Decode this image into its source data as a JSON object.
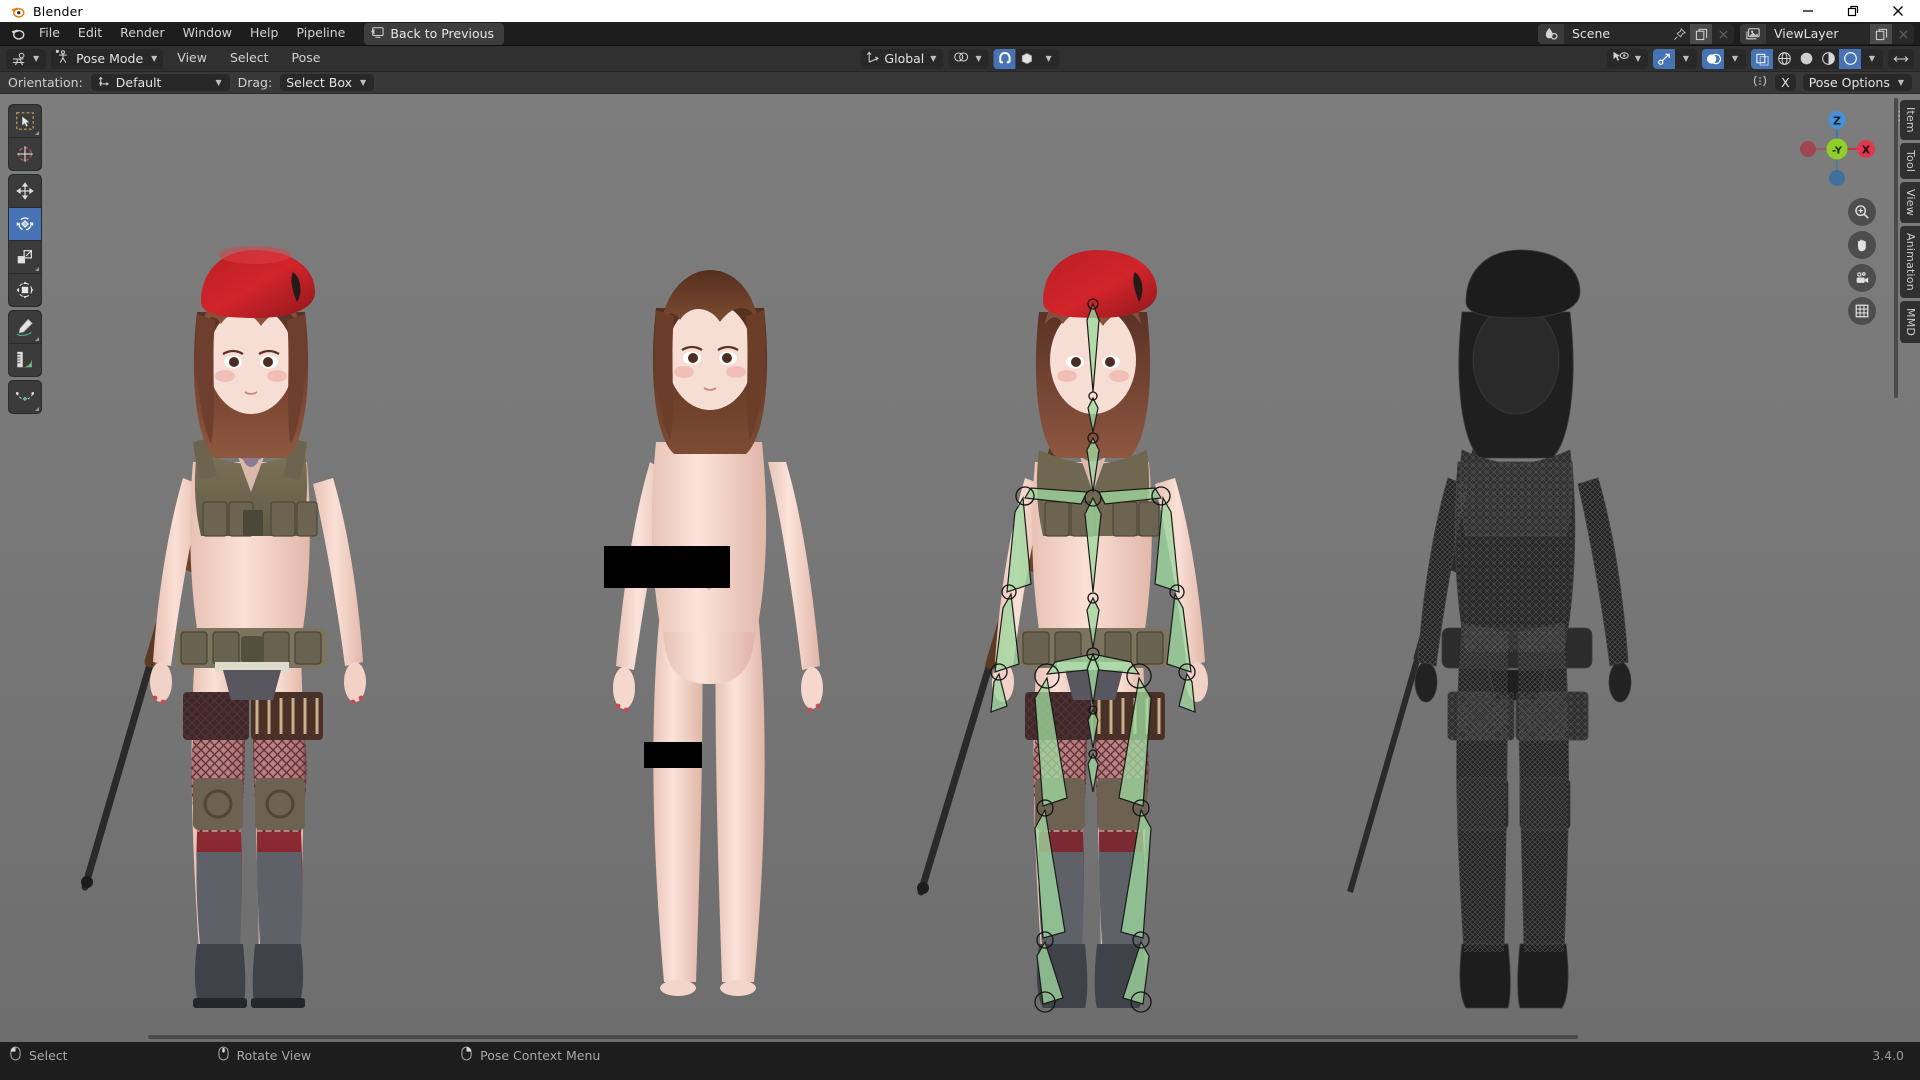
{
  "window": {
    "title": "Blender",
    "controls": {
      "minimize": "minimize",
      "maximize": "maximize",
      "close": "close"
    }
  },
  "topbar": {
    "menus": [
      "File",
      "Edit",
      "Render",
      "Window",
      "Help",
      "Pipeline"
    ],
    "back_button": "Back to Previous",
    "scene": {
      "label": "Scene",
      "name_value": "Scene"
    },
    "viewlayer": {
      "label": "ViewLayer",
      "name_value": "ViewLayer"
    }
  },
  "viewport_header": {
    "editor_type": "editor-type-3dview",
    "mode": "Pose Mode",
    "menus": [
      "View",
      "Select",
      "Pose"
    ],
    "transform_orientation": "Global",
    "snap_enabled": true,
    "proportional_editing": false,
    "shading": {
      "wireframe": false,
      "solid": false,
      "material": false,
      "rendered": true
    },
    "gizmo_enabled": true,
    "overlays_enabled": true,
    "xray": false
  },
  "tool_settings": {
    "orientation_label": "Orientation:",
    "orientation_value": "Default",
    "drag_label": "Drag:",
    "drag_value": "Select Box",
    "xmirror_label": "X",
    "pose_options": "Pose Options"
  },
  "toolbar": {
    "tools": [
      {
        "name": "tool-select-box",
        "label": "Select Box",
        "active": false
      },
      {
        "name": "tool-cursor",
        "label": "Cursor",
        "active": false
      },
      {
        "name": "tool-move",
        "label": "Move",
        "active": false
      },
      {
        "name": "tool-rotate",
        "label": "Rotate",
        "active": true
      },
      {
        "name": "tool-scale",
        "label": "Scale",
        "active": false
      },
      {
        "name": "tool-transform",
        "label": "Transform",
        "active": false
      },
      {
        "name": "tool-annotate",
        "label": "Annotate",
        "active": false
      },
      {
        "name": "tool-measure",
        "label": "Measure",
        "active": false
      },
      {
        "name": "tool-breakdowner",
        "label": "Breakdowner",
        "active": false
      }
    ]
  },
  "sidebar": {
    "tabs": [
      {
        "label": "Item",
        "active": false
      },
      {
        "label": "Tool",
        "active": false
      },
      {
        "label": "View",
        "active": false
      },
      {
        "label": "Animation",
        "active": false
      },
      {
        "label": "MMD",
        "active": false
      }
    ]
  },
  "nav_gizmo": {
    "axes": [
      {
        "label": "Z",
        "color": "#4a8fd4",
        "active": false
      },
      {
        "label": "-Y",
        "color": "#8fcf2a",
        "active": true
      },
      {
        "label": "X",
        "color": "#e0384f",
        "active": false
      }
    ],
    "buttons": [
      "zoom-icon",
      "pan-hand-icon",
      "camera-icon",
      "grid-icon"
    ]
  },
  "viewport": {
    "background_color": "#787878",
    "bone_color": "#9fd89f",
    "figures": [
      {
        "name": "figure-textured-clothed",
        "label": "Textured character with red beret, tactical vest, rifle"
      },
      {
        "name": "figure-body-only",
        "label": "Untextured body mesh"
      },
      {
        "name": "figure-armature-overlay",
        "label": "Character with pose armature bones shown"
      },
      {
        "name": "figure-wireframe",
        "label": "Wireframe / dark shaded character"
      }
    ]
  },
  "statusbar": {
    "hints": [
      {
        "icon": "mouse-left-icon",
        "label": "Select"
      },
      {
        "icon": "mouse-middle-icon",
        "label": "Rotate View"
      },
      {
        "icon": "mouse-right-icon",
        "label": "Pose Context Menu"
      }
    ],
    "version": "3.4.0"
  }
}
